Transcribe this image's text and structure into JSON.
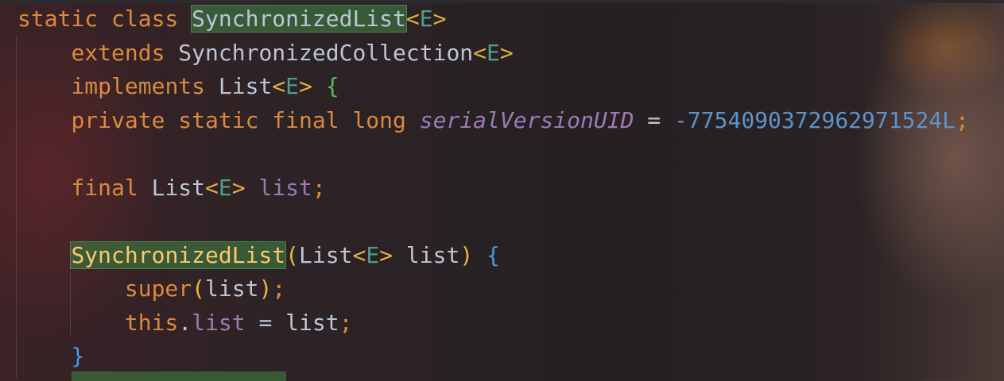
{
  "editor": {
    "lines": [
      [
        [
          "static class ",
          "kw"
        ],
        [
          "SynchronizedList",
          "cls hl"
        ],
        [
          "<",
          "ang"
        ],
        [
          "E",
          "tp"
        ],
        [
          ">",
          "ang"
        ]
      ],
      [
        [
          "    ",
          ""
        ],
        [
          "extends ",
          "kw"
        ],
        [
          "SynchronizedCollection",
          "cls"
        ],
        [
          "<",
          "ang"
        ],
        [
          "E",
          "tp"
        ],
        [
          ">",
          "ang"
        ]
      ],
      [
        [
          "    ",
          ""
        ],
        [
          "implements ",
          "kw"
        ],
        [
          "List",
          "cls"
        ],
        [
          "<",
          "ang"
        ],
        [
          "E",
          "tp"
        ],
        [
          "> ",
          "ang"
        ],
        [
          "{",
          "br1"
        ]
      ],
      [
        [
          "    ",
          ""
        ],
        [
          "private static final long ",
          "kw"
        ],
        [
          "serialVersionUID",
          "fld ital"
        ],
        [
          " = ",
          "plain"
        ],
        [
          "-7754090372962971524L",
          "num"
        ],
        [
          ";",
          "semi"
        ]
      ],
      [],
      [
        [
          "    ",
          ""
        ],
        [
          "final ",
          "kw"
        ],
        [
          "List",
          "cls"
        ],
        [
          "<",
          "ang"
        ],
        [
          "E",
          "tp"
        ],
        [
          "> ",
          "ang"
        ],
        [
          "list",
          "fld"
        ],
        [
          ";",
          "semi"
        ]
      ],
      [],
      [
        [
          "    ",
          ""
        ],
        [
          "SynchronizedList",
          "fn hl"
        ],
        [
          "(",
          "par"
        ],
        [
          "List",
          "cls"
        ],
        [
          "<",
          "ang"
        ],
        [
          "E",
          "tp"
        ],
        [
          "> ",
          "ang"
        ],
        [
          "list",
          "plain"
        ],
        [
          ")",
          "par"
        ],
        [
          " ",
          ""
        ],
        [
          "{",
          "br2"
        ]
      ],
      [
        [
          "        ",
          ""
        ],
        [
          "super",
          "kw"
        ],
        [
          "(",
          "par"
        ],
        [
          "list",
          "plain"
        ],
        [
          ")",
          "par"
        ],
        [
          ";",
          "semi"
        ]
      ],
      [
        [
          "        ",
          ""
        ],
        [
          "this",
          "kw"
        ],
        [
          ".",
          "plain"
        ],
        [
          "list",
          "fld"
        ],
        [
          " = ",
          "plain"
        ],
        [
          "list",
          "plain"
        ],
        [
          ";",
          "semi"
        ]
      ],
      [
        [
          "    ",
          ""
        ],
        [
          "}",
          "br2"
        ]
      ]
    ]
  }
}
